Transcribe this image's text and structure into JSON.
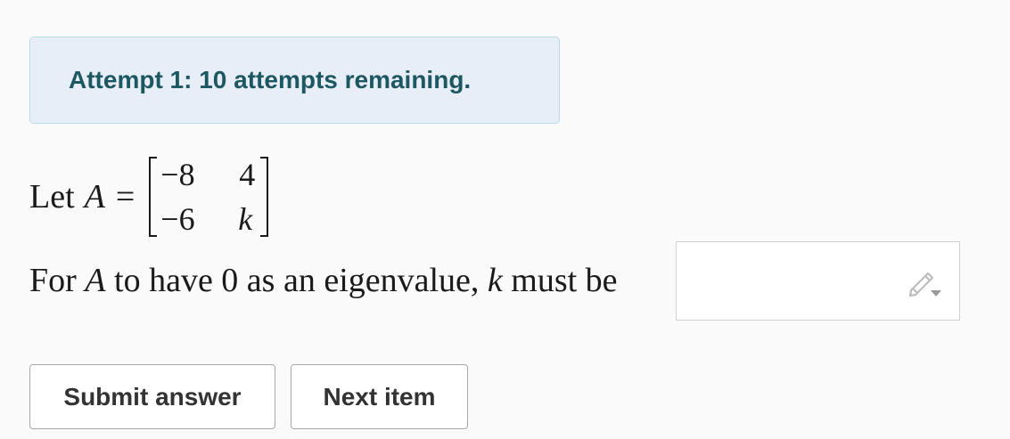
{
  "alert": {
    "text": "Attempt 1: 10 attempts remaining."
  },
  "question": {
    "intro": "Let",
    "matrix_var": "A",
    "equals": "=",
    "matrix": [
      [
        "−8",
        "4"
      ],
      [
        "−6",
        "k"
      ]
    ],
    "prompt_part1": "For",
    "prompt_var": "A",
    "prompt_part2": "to have 0 as an eigenvalue,",
    "prompt_var2": "k",
    "prompt_part3": "must be"
  },
  "answer": {
    "value": "",
    "icon": "pencil-icon"
  },
  "buttons": {
    "submit_label": "Submit answer",
    "next_label": "Next item"
  },
  "colors": {
    "alert_bg": "#e7eef8",
    "alert_border": "#b6dce6",
    "alert_text": "#1d5761"
  }
}
